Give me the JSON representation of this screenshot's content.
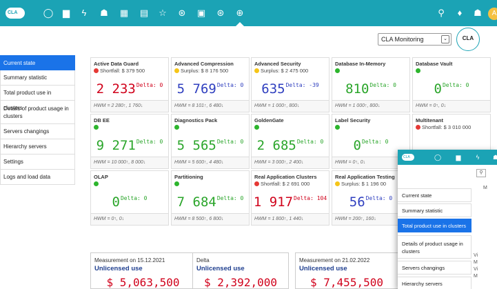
{
  "topbar": {
    "logo_text": "CLA",
    "icons": [
      "circle-icon",
      "folder-icon",
      "bolt-icon",
      "users-icon",
      "calendar-icon",
      "database-icon",
      "star-icon",
      "shield-icon",
      "server-icon",
      "globe-icon",
      "globe-active-icon"
    ],
    "right_icons": [
      "search-icon",
      "bell-icon",
      "user-add-icon"
    ],
    "avatar": "A"
  },
  "selector": {
    "value": "CLA Monitoring",
    "logo": "CLA group"
  },
  "sidebar": {
    "items": [
      {
        "label": "Current state",
        "active": true
      },
      {
        "label": "Summary statistic",
        "active": false
      },
      {
        "label": "Total product use in clusters",
        "active": false
      },
      {
        "label": "Details of product usage in clusters",
        "active": false
      },
      {
        "label": "Servers changings",
        "active": false
      },
      {
        "label": "Hierarchy servers",
        "active": false
      },
      {
        "label": "Settings",
        "active": false
      },
      {
        "label": "Logs and load data",
        "active": false
      }
    ]
  },
  "cards": [
    {
      "name": "Active Data Guard",
      "status_color": "red",
      "status": "Shortfall: $ 379 500",
      "value": "2 233",
      "value_color": "red",
      "delta": "Delta: 0",
      "hwm": "HWM = 2 280↑, 1 760↓"
    },
    {
      "name": "Advanced Compression",
      "status_color": "yellow",
      "status": "Surplus: $ 8 176 500",
      "value": "5 769",
      "value_color": "blue",
      "delta": "Delta: 0",
      "hwm": "HWM = 8 101↑, 6 480↓"
    },
    {
      "name": "Advanced Security",
      "status_color": "yellow",
      "status": "Surplus: $ 2 475 000",
      "value": "635",
      "value_color": "blue",
      "delta": "Delta: -39",
      "hwm": "HWM = 1 000↑, 800↓"
    },
    {
      "name": "Database In-Memory",
      "status_color": "green",
      "status": "",
      "value": "810",
      "value_color": "green",
      "delta": "Delta: 0",
      "hwm": "HWM = 1 000↑, 800↓"
    },
    {
      "name": "Database Vault",
      "status_color": "green",
      "status": "",
      "value": "0",
      "value_color": "green",
      "delta": "Delta: 0",
      "hwm": "HWM = 0↑, 0↓"
    },
    {
      "name": "DB EE",
      "status_color": "green",
      "status": "",
      "value": "9 271",
      "value_color": "green",
      "delta": "Delta: 0",
      "hwm": "HWM = 10 000↑, 8 000↓"
    },
    {
      "name": "Diagnostics Pack",
      "status_color": "green",
      "status": "",
      "value": "5 565",
      "value_color": "green",
      "delta": "Delta: 0",
      "hwm": "HWM = 5 600↑, 4 480↓"
    },
    {
      "name": "GoldenGate",
      "status_color": "green",
      "status": "",
      "value": "2 685",
      "value_color": "green",
      "delta": "Delta: 0",
      "hwm": "HWM = 3 000↑, 2 400↓"
    },
    {
      "name": "Label Security",
      "status_color": "green",
      "status": "",
      "value": "0",
      "value_color": "green",
      "delta": "Delta: 0",
      "hwm": "HWM = 0↑, 0↓"
    },
    {
      "name": "Multitenant",
      "status_color": "red",
      "status": "Shortfall: $ 3 010 000",
      "value": "",
      "value_color": "red",
      "delta": "",
      "hwm": ""
    },
    {
      "name": "OLAP",
      "status_color": "green",
      "status": "",
      "value": "0",
      "value_color": "green",
      "delta": "Delta: 0",
      "hwm": "HWM = 0↑, 0↓"
    },
    {
      "name": "Partitioning",
      "status_color": "green",
      "status": "",
      "value": "7 684",
      "value_color": "green",
      "delta": "Delta: 0",
      "hwm": "HWM = 8 500↑, 6 800↓"
    },
    {
      "name": "Real Application Clusters",
      "status_color": "red",
      "status": "Shortfall: $ 2 691 000",
      "value": "1 917",
      "value_color": "red",
      "delta": "Delta: 104",
      "hwm": "HWM = 1 800↑, 1 440↓"
    },
    {
      "name": "Real Application Testing",
      "status_color": "yellow",
      "status": "Surplus: $ 1 196 00",
      "value": "56",
      "value_color": "blue",
      "delta": "Delta: 0",
      "hwm": "HWM = 200↑, 160↓"
    }
  ],
  "measurements": [
    {
      "title": "Measurement on 15.12.2021",
      "subtitle": "Unlicensed use",
      "value": "$ 5,063,500"
    },
    {
      "title": "Delta",
      "subtitle": "Unlicensed use",
      "value": "$ 2,392,000"
    },
    {
      "title": "Measurement on 21.02.2022",
      "subtitle": "Unlicensed use",
      "value": "$ 7,455,500"
    }
  ],
  "popup": {
    "logo_text": "CLA",
    "items": [
      {
        "label": "Current state",
        "active": false
      },
      {
        "label": "Summary statistic",
        "active": false
      },
      {
        "label": "Total product use in clusters",
        "active": true
      },
      {
        "label": "Details of product usage in clusters",
        "active": false
      },
      {
        "label": "Servers changings",
        "active": false
      },
      {
        "label": "Hierarchy servers",
        "active": false
      }
    ],
    "right_text": [
      "M",
      "Vi",
      "M",
      "Vi",
      "M"
    ]
  }
}
